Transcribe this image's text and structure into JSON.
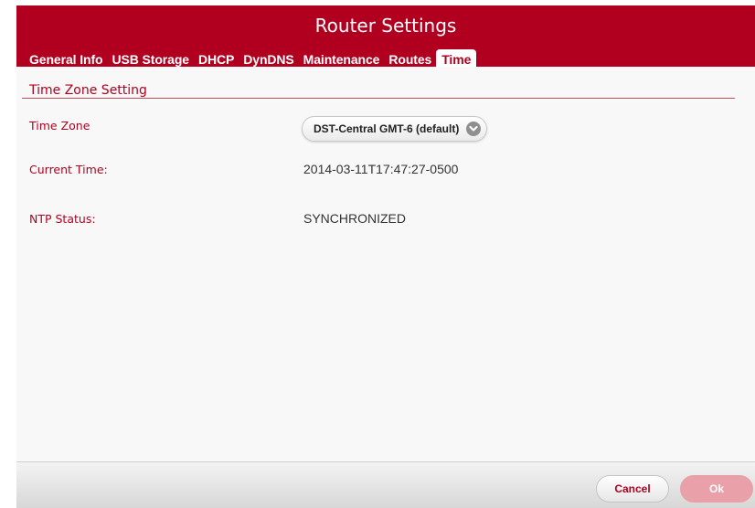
{
  "header": {
    "title": "Router Settings"
  },
  "tabs": [
    {
      "label": "General Info"
    },
    {
      "label": "USB Storage"
    },
    {
      "label": "DHCP"
    },
    {
      "label": "DynDNS"
    },
    {
      "label": "Maintenance"
    },
    {
      "label": "Routes"
    },
    {
      "label": "Time",
      "active": true
    }
  ],
  "section": {
    "title": "Time Zone Setting"
  },
  "fields": {
    "time_zone": {
      "label": "Time Zone",
      "selected": "DST-Central GMT-6 (default)"
    },
    "current_time": {
      "label": "Current Time:",
      "value": "2014-03-11T17:47:27-0500"
    },
    "ntp_status": {
      "label": "NTP Status:",
      "value": "SYNCHRONIZED"
    }
  },
  "footer": {
    "cancel_label": "Cancel",
    "ok_label": "Ok"
  },
  "colors": {
    "accent": "#b1001f",
    "ok_disabled": "#e9a0a9"
  }
}
